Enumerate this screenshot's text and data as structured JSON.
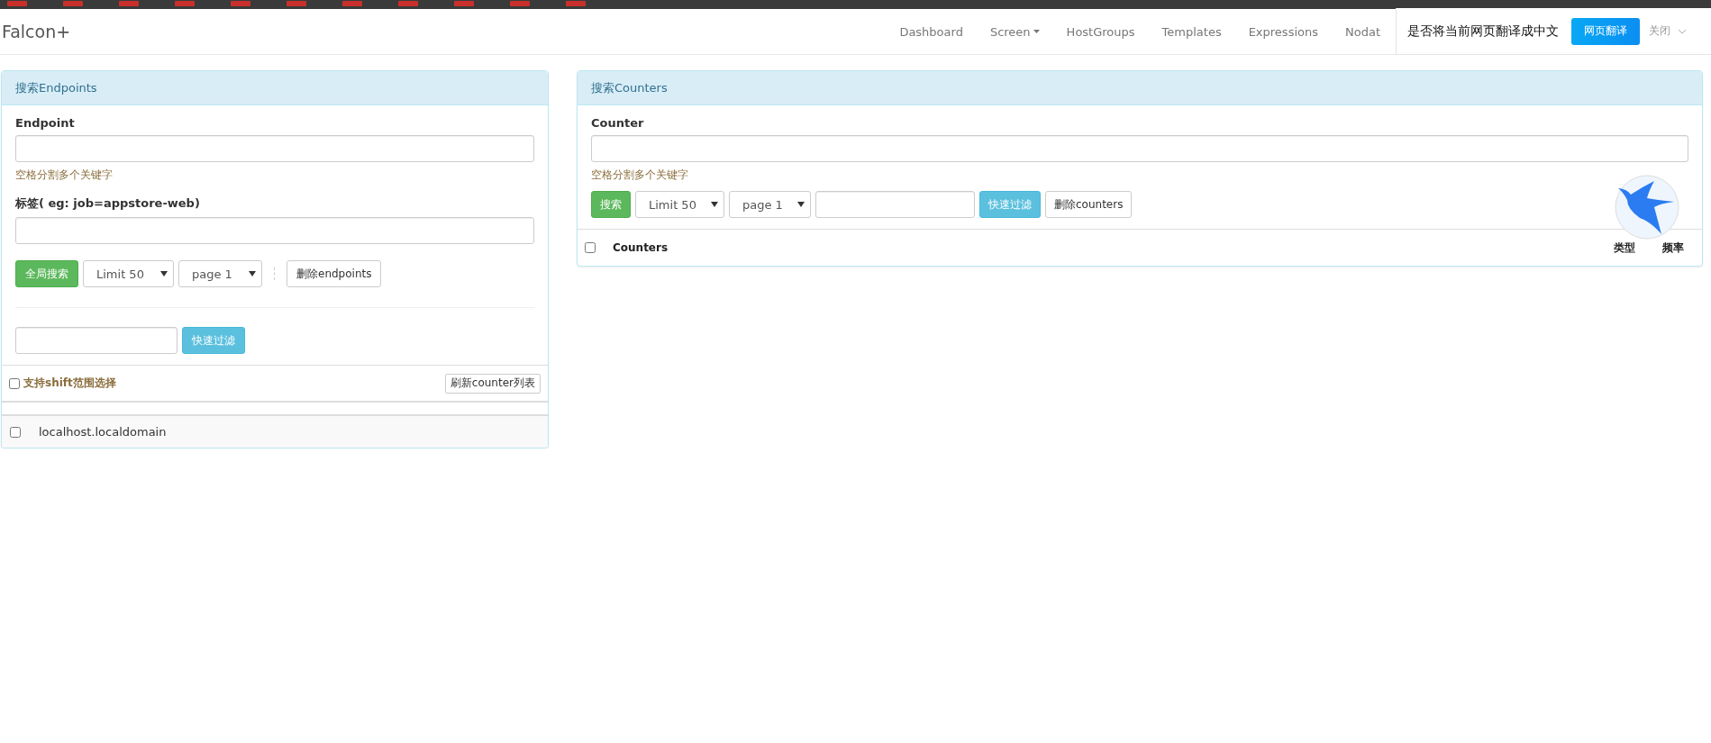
{
  "navbar": {
    "brand": "Falcon+",
    "items": [
      {
        "label": "Dashboard",
        "dropdown": false
      },
      {
        "label": "Screen",
        "dropdown": true
      },
      {
        "label": "HostGroups",
        "dropdown": false
      },
      {
        "label": "Templates",
        "dropdown": false
      },
      {
        "label": "Expressions",
        "dropdown": false
      },
      {
        "label": "Nodat",
        "dropdown": false
      }
    ]
  },
  "translate_bar": {
    "prompt": "是否将当前网页翻译成中文",
    "translate_button": "网页翻译",
    "close": "关闭"
  },
  "endpoints_panel": {
    "title": "搜索Endpoints",
    "endpoint_label": "Endpoint",
    "endpoint_help": "空格分割多个关键字",
    "tags_label": "标签( eg: job=appstore-web)",
    "search_button": "全局搜索",
    "limit_select": "Limit 50",
    "page_select": "page 1",
    "delete_button": "删除endpoints",
    "filter_button": "快速过滤",
    "shift_select": {
      "label": "支持shift范围选择",
      "checked": false
    },
    "refresh_button": "刷新counter列表",
    "rows": [
      {
        "name": "localhost.localdomain",
        "checked": false
      }
    ]
  },
  "counters_panel": {
    "title": "搜索Counters",
    "counter_label": "Counter",
    "counter_help": "空格分割多个关键字",
    "search_button": "搜索",
    "limit_select": "Limit 50",
    "page_select": "page 1",
    "filter_button": "快速过滤",
    "delete_button": "删除counters",
    "select_all": {
      "checked": false
    },
    "columns": [
      {
        "label": "Counters"
      },
      {
        "label": "类型"
      },
      {
        "label": "频率"
      }
    ]
  }
}
